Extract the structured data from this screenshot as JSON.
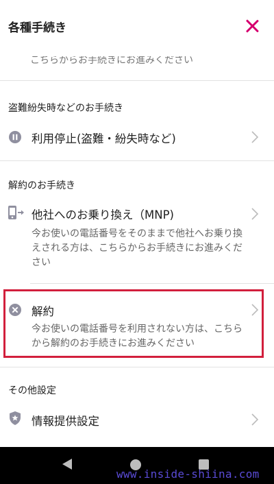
{
  "header": {
    "title": "各種手続き"
  },
  "cut_text": "こちらからお手続きにお進みください",
  "sections": {
    "theft": {
      "title": "盗難紛失時などのお手続き",
      "item_title": "利用停止(盗難・紛失時など)"
    },
    "cancel": {
      "title": "解約のお手続き",
      "mnp_title": "他社へのお乗り換え（MNP)",
      "mnp_desc": "今お使いの電話番号をそのままで他社へお乗り換えされる方は、こちらからお手続きにお進みください",
      "kaiyaku_title": "解約",
      "kaiyaku_desc": "今お使いの電話番号を利用されない方は、こちらから解約のお手続きにお進みください"
    },
    "other": {
      "title": "その他設定",
      "item_title": "情報提供設定"
    }
  },
  "watermark": "www.inside-shiina.com",
  "colors": {
    "accent": "#d6006f",
    "highlight": "#d21f3c",
    "watermark": "#5a4bd6"
  }
}
